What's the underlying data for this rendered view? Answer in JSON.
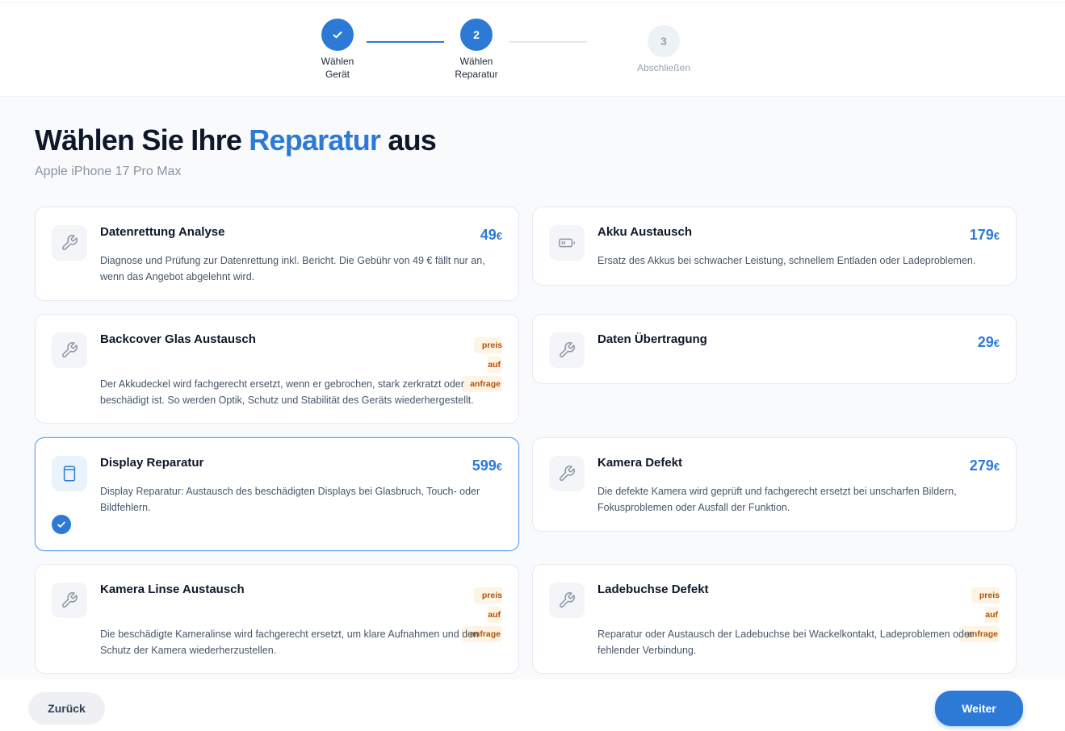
{
  "stepper": {
    "steps": [
      {
        "number": "1",
        "label_line1": "Wählen",
        "label_line2": "Gerät",
        "state": "done"
      },
      {
        "number": "2",
        "label_line1": "Wählen",
        "label_line2": "Reparatur",
        "state": "active"
      },
      {
        "number": "3",
        "label_line1": "Abschließen",
        "label_line2": "",
        "state": "pending"
      }
    ]
  },
  "page": {
    "title_prefix": "Wählen Sie Ihre ",
    "title_accent": "Reparatur",
    "title_suffix": " aus",
    "subtitle": "Apple iPhone 17 Pro Max"
  },
  "repairs": [
    {
      "title": "Datenrettung Analyse",
      "price": "49",
      "currency": "€",
      "badge_line1": "",
      "badge_line2": "",
      "description": "Diagnose und Prüfung zur Datenrettung inkl. Bericht. Die Gebühr von 49 € fällt nur an, wenn das Angebot abgelehnt wird.",
      "icon": "wrench-icon",
      "selected": false
    },
    {
      "title": "Akku Austausch",
      "price": "179",
      "currency": "€",
      "badge_line1": "",
      "badge_line2": "",
      "description": "Ersatz des Akkus bei schwacher Leistung, schnellem Entladen oder Ladeproblemen.",
      "icon": "battery-icon",
      "selected": false
    },
    {
      "title": "Backcover Glas Austausch",
      "price": "",
      "currency": "",
      "badge_line1": "preis auf",
      "badge_line2": "anfrage",
      "description": "Der Akkudeckel wird fachgerecht ersetzt, wenn er gebrochen, stark zerkratzt oder beschädigt ist. So werden Optik, Schutz und Stabilität des Geräts wiederhergestellt.",
      "icon": "wrench-icon",
      "selected": false
    },
    {
      "title": "Daten Übertragung",
      "price": "29",
      "currency": "€",
      "badge_line1": "",
      "badge_line2": "",
      "description": "",
      "icon": "wrench-icon",
      "selected": false
    },
    {
      "title": "Display Reparatur",
      "price": "599",
      "currency": "€",
      "badge_line1": "",
      "badge_line2": "",
      "description": "Display Reparatur: Austausch des beschädigten Displays bei Glasbruch, Touch- oder Bildfehlern.",
      "icon": "display-icon",
      "selected": true
    },
    {
      "title": "Kamera Defekt",
      "price": "279",
      "currency": "€",
      "badge_line1": "",
      "badge_line2": "",
      "description": "Die defekte Kamera wird geprüft und fachgerecht ersetzt bei unscharfen Bildern, Fokusproblemen oder Ausfall der Funktion.",
      "icon": "wrench-icon",
      "selected": false
    },
    {
      "title": "Kamera Linse Austausch",
      "price": "",
      "currency": "",
      "badge_line1": "preis auf",
      "badge_line2": "anfrage",
      "description": "Die beschädigte Kameralinse wird fachgerecht ersetzt, um klare Aufnahmen und den Schutz der Kamera wiederherzustellen.",
      "icon": "wrench-icon",
      "selected": false
    },
    {
      "title": "Ladebuchse Defekt",
      "price": "",
      "currency": "",
      "badge_line1": "preis auf",
      "badge_line2": "anfrage",
      "description": "Reparatur oder Austausch der Ladebuchse bei Wackelkontakt, Ladeproblemen oder fehlender Verbindung.",
      "icon": "wrench-icon",
      "selected": false
    }
  ],
  "footer": {
    "back_label": "Zurück",
    "next_label": "Weiter"
  },
  "colors": {
    "accent": "#2d7ad6",
    "badge_text": "#b45309",
    "badge_bg": "#fdf4e3"
  }
}
